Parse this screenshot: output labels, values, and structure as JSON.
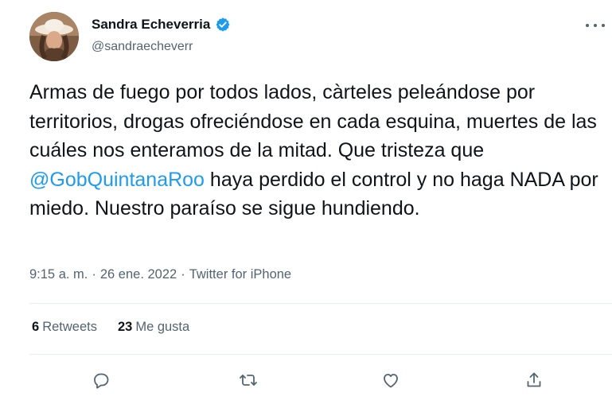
{
  "user": {
    "name": "Sandra Echeverria",
    "handle": "@sandraecheverr"
  },
  "tweet": {
    "text_before": "Armas de fuego por todos lados, càrteles peleándose por territorios, drogas ofreciéndose en cada esquina, muertes de las cuáles nos enteramos de la mitad. Que tristeza que ",
    "mention": "@GobQuintanaRoo",
    "text_after": " haya perdido el control y no haga NADA por miedo. Nuestro paraíso se sigue hundiendo."
  },
  "meta": {
    "time": "9:15 a. m.",
    "sep1": "·",
    "date": "26 ene. 2022",
    "sep2": "·",
    "source": "Twitter for iPhone"
  },
  "stats": {
    "retweets_count": "6",
    "retweets_label": "Retweets",
    "likes_count": "23",
    "likes_label": "Me gusta"
  },
  "colors": {
    "accent": "#1d9bf0",
    "secondary_text": "#536471",
    "divider": "#e6ecf0"
  },
  "icons": [
    "verified-badge-icon",
    "more-options-icon",
    "reply-icon",
    "retweet-icon",
    "like-icon",
    "share-icon"
  ]
}
